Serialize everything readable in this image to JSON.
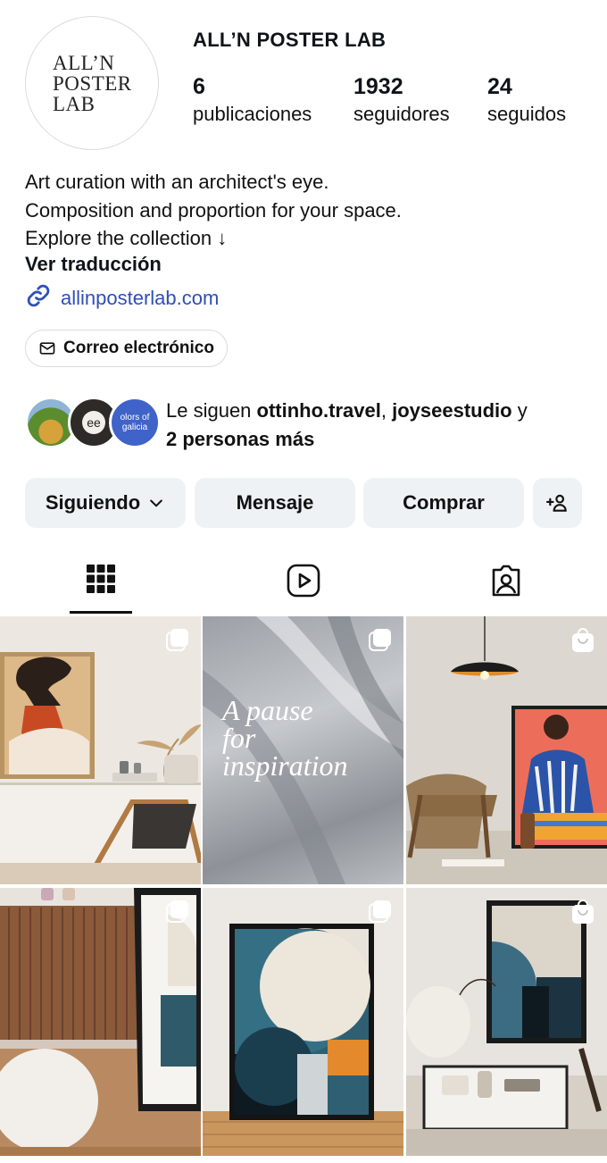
{
  "profile": {
    "avatar_lines": [
      "ALL’N",
      "POSTER",
      "LAB"
    ],
    "name": "ALL’N POSTER LAB",
    "stats": [
      {
        "value": "6",
        "label": "publicaciones"
      },
      {
        "value": "1932",
        "label": "seguidores"
      },
      {
        "value": "24",
        "label": "seguidos"
      }
    ]
  },
  "bio": {
    "lines": [
      "Art curation with an architect's eye.",
      "Composition and proportion for your space.",
      "Explore the collection ↓"
    ],
    "translate": "Ver traducción",
    "link": "allinposterlab.com",
    "email_chip": "Correo electrónico"
  },
  "followers": {
    "prefix": "Le siguen ",
    "user1": "ottinho.travel",
    "sep": ", ",
    "user2": "joyseestudio",
    "conj": " y",
    "more": "2 personas más",
    "avatar2_text": "ee",
    "avatar3_text": "olors of galicia"
  },
  "actions": {
    "following": "Siguiendo",
    "message": "Mensaje",
    "shop": "Comprar"
  },
  "grid": {
    "post2_text": [
      "A pause",
      "for",
      "inspiration"
    ]
  },
  "colors": {
    "button_bg": "#eff2f5",
    "link": "#2f4fb8"
  }
}
